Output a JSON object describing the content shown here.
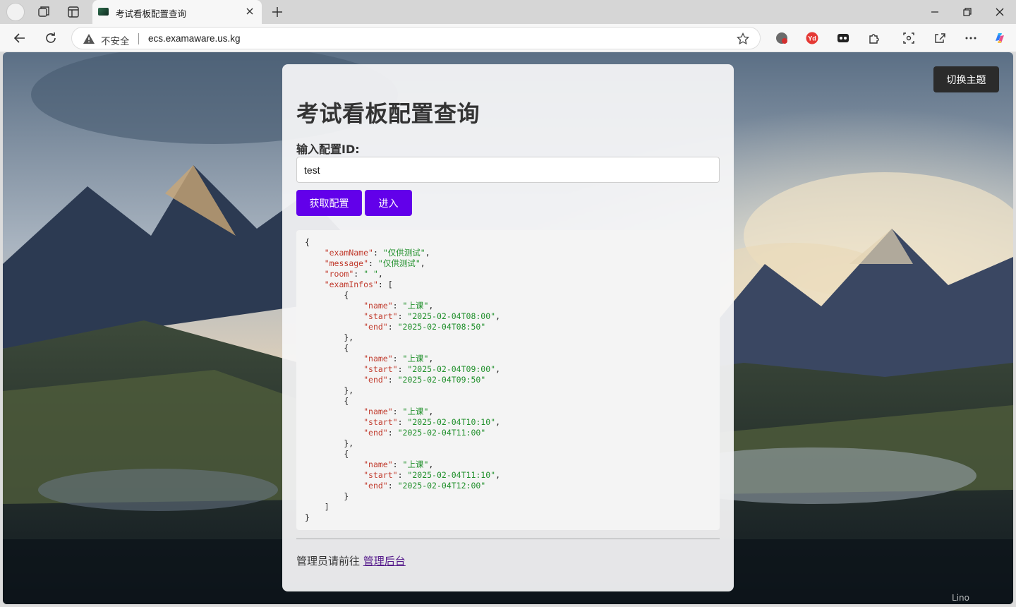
{
  "browser": {
    "tab_title": "考试看板配置查询",
    "insecure_label": "不安全",
    "url": "ecs.examaware.us.kg"
  },
  "page": {
    "theme_button": "切换主题",
    "title": "考试看板配置查询",
    "input_label": "输入配置ID:",
    "input_value": "test",
    "fetch_button": "获取配置",
    "enter_button": "进入",
    "footer_text": "管理员请前往 ",
    "footer_link": "管理后台",
    "watermark": "Lino"
  },
  "config": {
    "examName": "仅供测试",
    "message": "仅供测试",
    "room": " ",
    "examInfos": [
      {
        "name": "上课",
        "start": "2025-02-04T08:00",
        "end": "2025-02-04T08:50"
      },
      {
        "name": "上课",
        "start": "2025-02-04T09:00",
        "end": "2025-02-04T09:50"
      },
      {
        "name": "上课",
        "start": "2025-02-04T10:10",
        "end": "2025-02-04T11:00"
      },
      {
        "name": "上课",
        "start": "2025-02-04T11:10",
        "end": "2025-02-04T12:00"
      }
    ]
  },
  "colors": {
    "accent": "#6200ea",
    "theme_button_bg": "#2b2b2b",
    "json_key": "#c0392b",
    "json_string": "#1f8f2a",
    "link": "#551a8b"
  },
  "icons": [
    "profile-avatar",
    "workspaces-icon",
    "vertical-tabs-icon",
    "tab-favicon",
    "close-icon",
    "new-tab-icon",
    "minimize-icon",
    "restore-icon",
    "window-close-icon",
    "back-icon",
    "refresh-icon",
    "warning-icon",
    "favorite-star-icon",
    "extension-icons",
    "extensions-puzzle-icon",
    "screenshot-icon",
    "share-icon",
    "more-icon",
    "copilot-icon"
  ]
}
